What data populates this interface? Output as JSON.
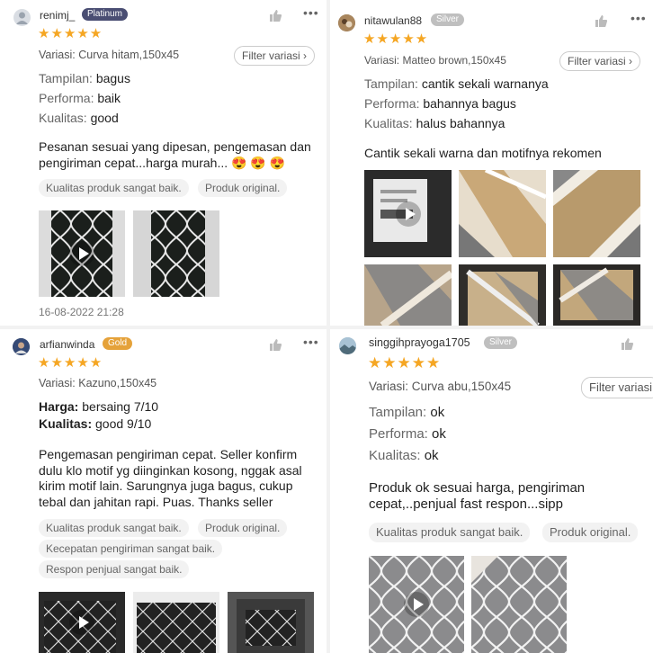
{
  "colors": {
    "star": "#f5a623",
    "platinum": "#4a4e73",
    "silver": "#bfbfbf",
    "gold": "#e5a23a"
  },
  "icons": {
    "like": "thumbs-up-icon",
    "more": "more-dots-icon",
    "play": "play-icon",
    "chevron": "chevron-right-icon"
  },
  "reviews": [
    {
      "user": "renimj_",
      "badge": "Platinum",
      "stars": "★★★★★",
      "variasi": "Variasi: Curva hitam,150x45",
      "filter": "Filter variasi",
      "attrs": [
        {
          "k": "Tampilan:",
          "v": "bagus"
        },
        {
          "k": "Performa:",
          "v": "baik"
        },
        {
          "k": "Kualitas:",
          "v": "good"
        }
      ],
      "text": "Pesanan sesuai yang dipesan, pengemasan dan pengiriman cepat...harga murah... 😍 😍 😍",
      "tags": [
        "Kualitas produk sangat baik.",
        "Produk original."
      ],
      "date": "16-08-2022 21:28"
    },
    {
      "user": "nitawulan88",
      "badge": "Silver",
      "stars": "★★★★★",
      "variasi": "Variasi: Matteo brown,150x45",
      "filter": "Filter variasi",
      "attrs": [
        {
          "k": "Tampilan:",
          "v": "cantik sekali warnanya"
        },
        {
          "k": "Performa:",
          "v": "bahannya bagus"
        },
        {
          "k": "Kualitas:",
          "v": "halus bahannya"
        }
      ],
      "text": "Cantik sekali warna dan motifnya rekomen"
    },
    {
      "user": "arfianwinda",
      "badge": "Gold",
      "stars": "★★★★★",
      "variasi": "Variasi: Kazuno,150x45",
      "attrs": [
        {
          "k": "Harga:",
          "v": "bersaing 7/10"
        },
        {
          "k": "Kualitas:",
          "v": "good 9/10"
        }
      ],
      "text": "Pengemasan pengiriman cepat. Seller konfirm dulu klo motif yg diinginkan kosong, nggak asal kirim motif lain. Sarungnya juga bagus, cukup tebal dan jahitan rapi. Puas. Thanks seller",
      "tags": [
        "Kualitas produk sangat baik.",
        "Produk original.",
        "Kecepatan pengiriman sangat baik.",
        "Respon penjual sangat baik."
      ]
    },
    {
      "user": "singgihprayoga1705",
      "badge": "Silver",
      "stars": "★★★★★",
      "variasi": "Variasi: Curva abu,150x45",
      "filter": "Filter variasi",
      "attrs": [
        {
          "k": "Tampilan:",
          "v": "ok"
        },
        {
          "k": "Performa:",
          "v": "ok"
        },
        {
          "k": "Kualitas:",
          "v": "ok"
        }
      ],
      "text": "Produk ok sesuai harga, pengiriman cepat,..penjual fast respon...sipp",
      "tags": [
        "Kualitas produk sangat baik.",
        "Produk original."
      ]
    }
  ]
}
